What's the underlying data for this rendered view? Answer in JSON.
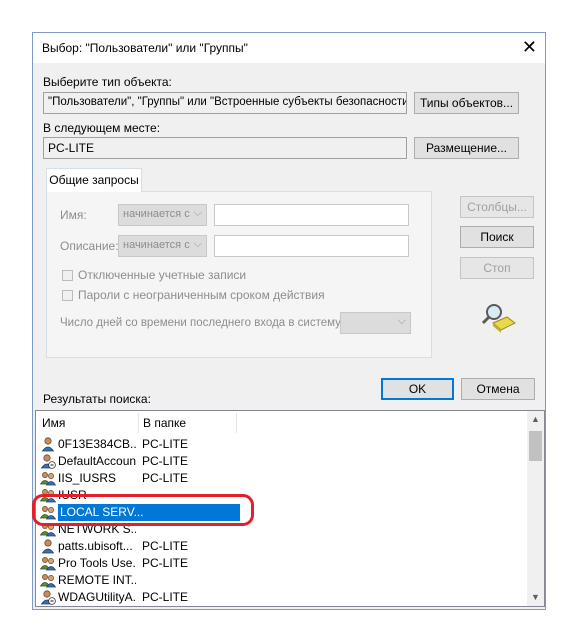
{
  "window": {
    "title": "Выбор: \"Пользователи\" или \"Группы\""
  },
  "object_type": {
    "label": "Выберите тип объекта:",
    "value": "\"Пользователи\", \"Группы\" или \"Встроенные субъекты безопасности\"",
    "button": "Типы объектов..."
  },
  "location": {
    "label": "В следующем месте:",
    "value": "PC-LITE",
    "button": "Размещение..."
  },
  "queries": {
    "tab": "Общие запросы",
    "name_label": "Имя:",
    "name_mode": "начинается с",
    "desc_label": "Описание:",
    "desc_mode": "начинается с",
    "disabled_accounts": "Отключенные учетные записи",
    "no_expire_passwords": "Пароли с неограниченным сроком действия",
    "days_label": "Число дней со времени последнего входа в систему:",
    "columns_button": "Столбцы...",
    "find_button": "Поиск",
    "stop_button": "Стоп"
  },
  "actions": {
    "ok": "OK",
    "cancel": "Отмена"
  },
  "results": {
    "label": "Результаты поиска:",
    "columns": [
      "Имя",
      "В папке"
    ],
    "rows": [
      {
        "name": "0F13E384CB...",
        "folder": "PC-LITE",
        "icon": "user-icon"
      },
      {
        "name": "DefaultAccount",
        "folder": "PC-LITE",
        "icon": "user-disabled-icon"
      },
      {
        "name": "IIS_IUSRS",
        "folder": "PC-LITE",
        "icon": "group-icon"
      },
      {
        "name": "IUSR",
        "folder": "",
        "icon": "group-icon"
      },
      {
        "name": "LOCAL SERV...",
        "folder": "",
        "icon": "group-icon"
      },
      {
        "name": "NETWORK S...",
        "folder": "",
        "icon": "group-icon"
      },
      {
        "name": "patts.ubisoft...",
        "folder": "PC-LITE",
        "icon": "user-icon"
      },
      {
        "name": "Pro Tools Use...",
        "folder": "PC-LITE",
        "icon": "group-icon"
      },
      {
        "name": "REMOTE INT...",
        "folder": "",
        "icon": "group-icon"
      },
      {
        "name": "WDAGUtilityA...",
        "folder": "PC-LITE",
        "icon": "user-disabled-icon"
      }
    ],
    "selected_index": 4
  },
  "colors": {
    "selection": "#0078d7",
    "highlight_outline": "#e0202a",
    "accent_border": "#7a9cc6"
  }
}
